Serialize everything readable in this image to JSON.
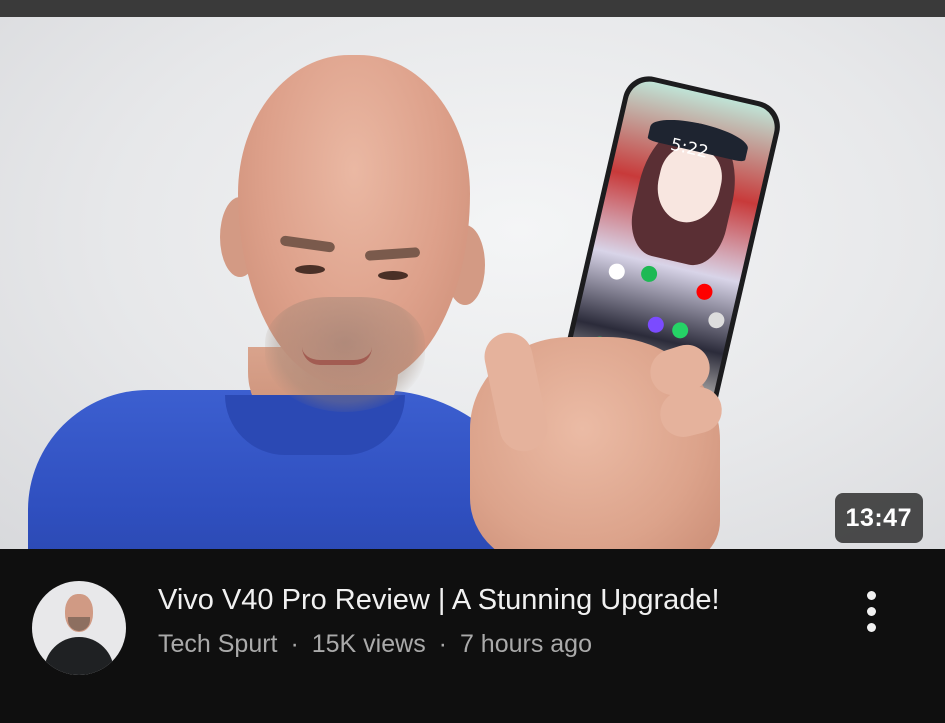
{
  "video": {
    "duration": "13:47",
    "title": "Vivo V40 Pro Review | A Stunning Upgrade!",
    "channel": "Tech Spurt",
    "separator": "·",
    "views": "15K views",
    "age": "7 hours ago"
  },
  "thumbnail_overlay": {
    "phone_clock": "5:22"
  },
  "icons": {
    "menu": "more-vert-icon"
  },
  "colors": {
    "background": "#0f0f0f",
    "title": "#f1f1f1",
    "meta_text": "#aaaaaa",
    "duration_badge": "#282828"
  }
}
